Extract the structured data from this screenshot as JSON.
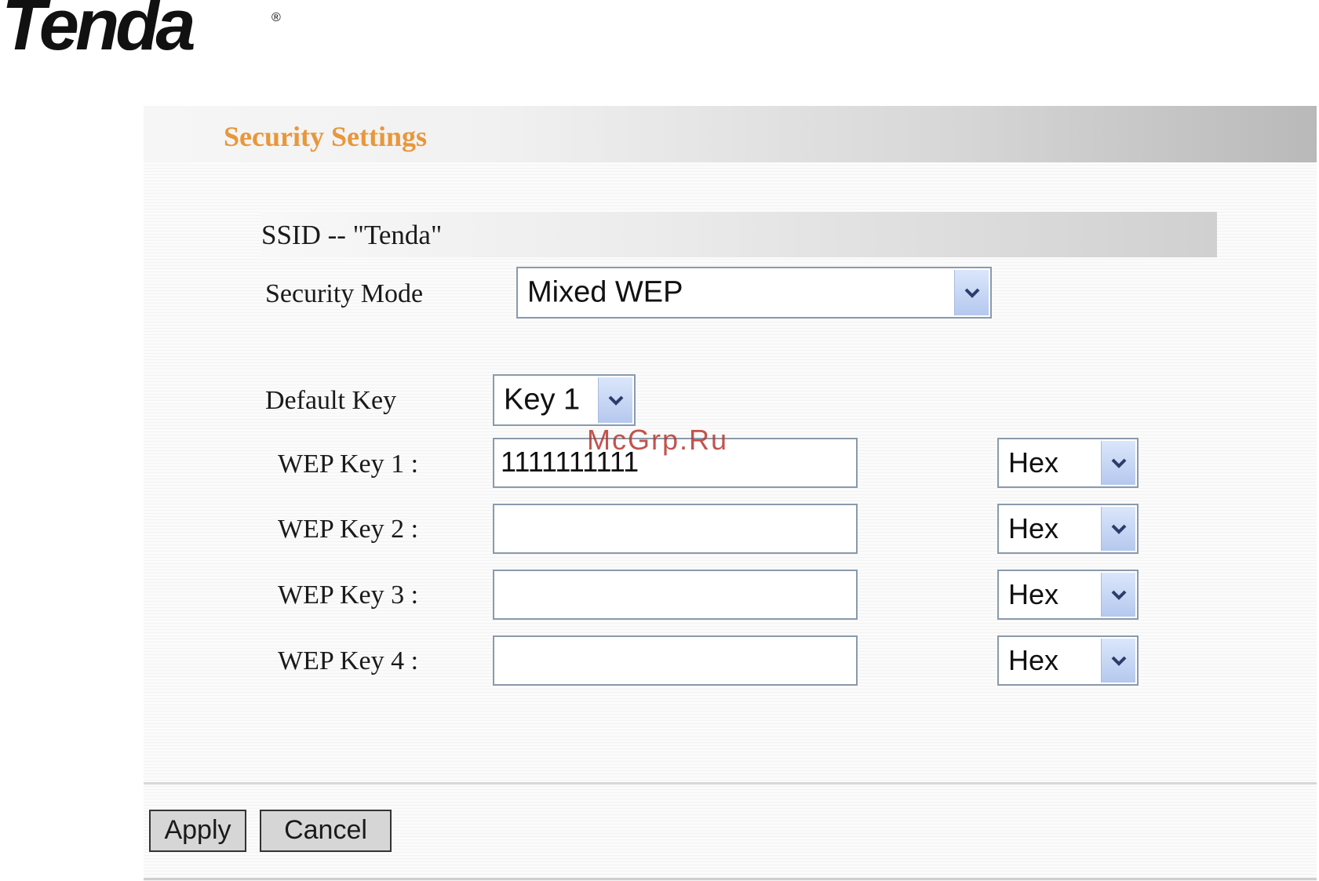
{
  "logo": {
    "text": "Tenda",
    "registered": "®"
  },
  "header": {
    "title": "Security Settings"
  },
  "ssid": {
    "text": "SSID -- \"Tenda\""
  },
  "security_mode": {
    "label": "Security Mode",
    "value": "Mixed WEP"
  },
  "default_key": {
    "label": "Default Key",
    "value": "Key 1"
  },
  "wep_keys": [
    {
      "label": "WEP Key 1 :",
      "value": "1111111111",
      "format": "Hex"
    },
    {
      "label": "WEP Key 2 :",
      "value": "",
      "format": "Hex"
    },
    {
      "label": "WEP Key 3 :",
      "value": "",
      "format": "Hex"
    },
    {
      "label": "WEP Key 4 :",
      "value": "",
      "format": "Hex"
    }
  ],
  "buttons": {
    "apply": "Apply",
    "cancel": "Cancel"
  },
  "watermark": {
    "text": "McGrp.Ru"
  },
  "colors": {
    "title_orange": "#e8973a",
    "dropdown_arrow_blue": "#b5c8ee",
    "watermark_red": "#b8372e"
  }
}
